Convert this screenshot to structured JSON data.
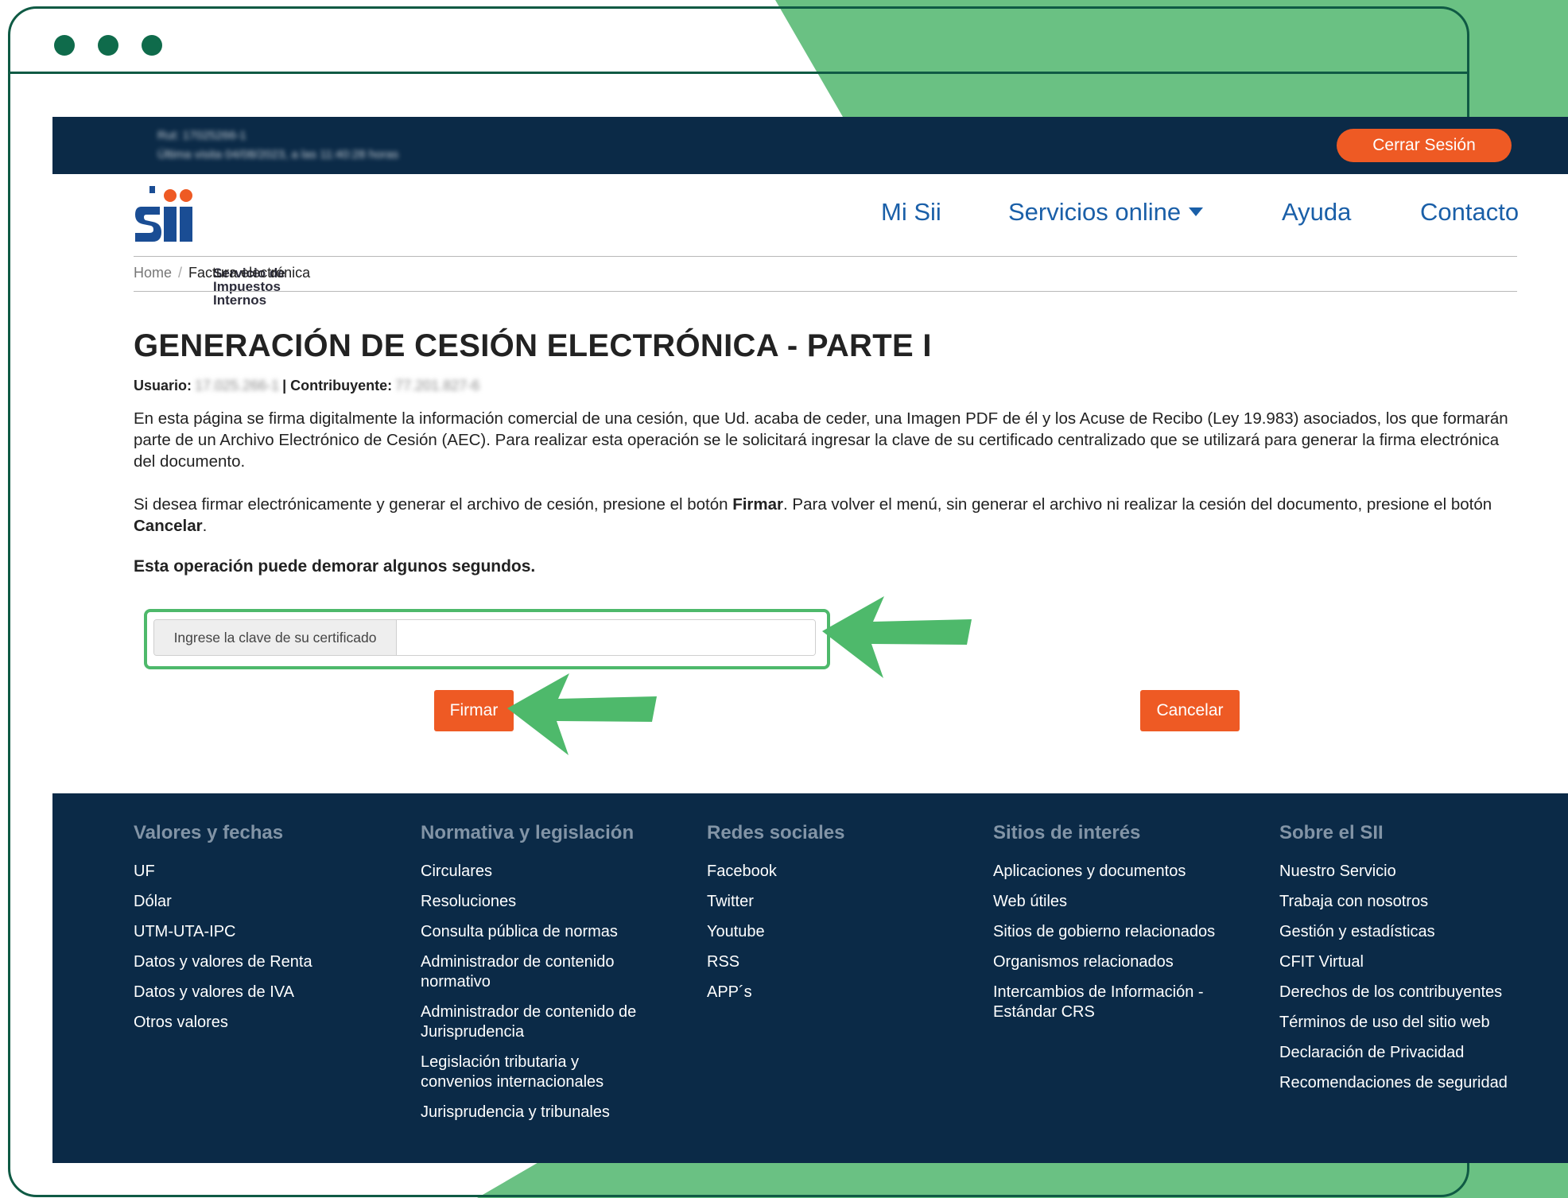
{
  "topbar": {
    "user_line1": "Rut: 17025266-1",
    "user_line2": "Última visita 04/08/2023, a las 11:40:28 horas",
    "logout_label": "Cerrar Sesión"
  },
  "logo": {
    "line1": "Servicio de",
    "line2": "Impuestos",
    "line3": "Internos"
  },
  "nav": {
    "items": [
      {
        "label": "Mi Sii"
      },
      {
        "label": "Servicios online"
      },
      {
        "label": "Ayuda"
      },
      {
        "label": "Contacto"
      }
    ]
  },
  "breadcrumb": {
    "home": "Home",
    "separator": "/",
    "current": "Factura electrónica"
  },
  "page": {
    "title": "GENERACIÓN DE CESIÓN ELECTRÓNICA - PARTE I",
    "usuario_label": "Usuario:",
    "usuario_value": "17.025.266-1",
    "separator": "|",
    "contribuyente_label": "Contribuyente:",
    "contribuyente_value": "77.201.827-6",
    "paragraph1": "En esta página se firma digitalmente la información comercial de una cesión, que Ud. acaba de ceder, una Imagen PDF de él y los Acuse de Recibo (Ley 19.983) asociados, los que formarán parte de un Archivo Electrónico de Cesión (AEC). Para realizar esta operación se le solicitará ingresar la clave de su certificado centralizado que se utilizará para generar la firma electrónica del documento.",
    "paragraph2_part1": "Si desea firmar electrónicamente y generar el archivo de cesión, presione el botón ",
    "paragraph2_firmar": "Firmar",
    "paragraph2_part2": ". Para volver el menú, sin generar el archivo ni realizar la cesión del documento, presione el botón ",
    "paragraph2_cancelar": "Cancelar",
    "paragraph2_end": ".",
    "notice": "Esta operación puede demorar algunos segundos."
  },
  "form": {
    "certificate_label": "Ingrese la clave de su certificado",
    "certificate_value": "",
    "sign_label": "Firmar",
    "cancel_label": "Cancelar"
  },
  "footer": {
    "columns": [
      {
        "heading": "Valores y fechas",
        "links": [
          "UF",
          "Dólar",
          "UTM-UTA-IPC",
          "Datos y valores de Renta",
          "Datos y valores de IVA",
          "Otros valores"
        ]
      },
      {
        "heading": "Normativa y legislación",
        "links": [
          "Circulares",
          "Resoluciones",
          "Consulta pública de normas",
          "Administrador de contenido normativo",
          "Administrador de contenido de Jurisprudencia",
          "Legislación tributaria y convenios internacionales",
          "Jurisprudencia y tribunales"
        ]
      },
      {
        "heading": "Redes sociales",
        "links": [
          "Facebook",
          "Twitter",
          "Youtube",
          "RSS",
          "APP´s"
        ]
      },
      {
        "heading": "Sitios de interés",
        "links": [
          "Aplicaciones y documentos",
          "Web útiles",
          "Sitios de gobierno relacionados",
          "Organismos relacionados",
          "Intercambios de Información - Estándar CRS"
        ]
      },
      {
        "heading": "Sobre el SII",
        "links": [
          "Nuestro Servicio",
          "Trabaja con nosotros",
          "Gestión y estadísticas",
          "CFIT Virtual",
          "Derechos de los contribuyentes",
          "Términos de uso del sitio web",
          "Declaración de Privacidad",
          "Recomendaciones de seguridad"
        ]
      }
    ]
  },
  "colors": {
    "brand_navy": "#0b2a47",
    "accent_orange": "#ee5a24",
    "link_blue": "#1a5fa8",
    "highlight_green": "#4eb96b",
    "frame_green": "#0f5a44",
    "decor_green": "#6ac183"
  }
}
